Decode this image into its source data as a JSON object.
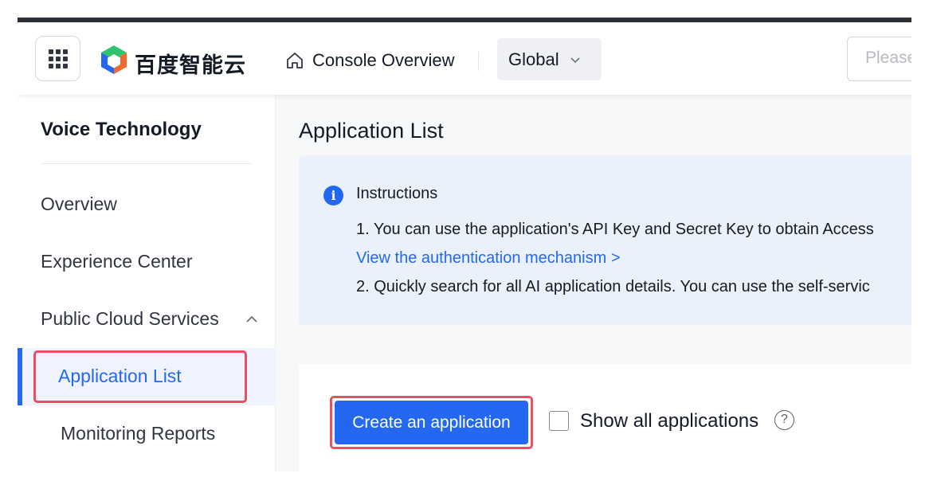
{
  "header": {
    "logo_text": "百度智能云",
    "console_label": "Console Overview",
    "region": "Global",
    "search_placeholder": "Please"
  },
  "sidebar": {
    "title": "Voice Technology",
    "items": [
      {
        "label": "Overview"
      },
      {
        "label": "Experience Center"
      },
      {
        "label": "Public Cloud Services"
      },
      {
        "label": "Application List"
      },
      {
        "label": "Monitoring Reports"
      }
    ]
  },
  "main": {
    "title": "Application List",
    "instructions": {
      "title": "Instructions",
      "line1": "1. You can use the application's API Key and Secret Key to obtain Access",
      "link": "View the authentication mechanism >",
      "line2": "2. Quickly search for all AI application details. You can use the self-servic"
    },
    "create_button": "Create an application",
    "show_all_label": "Show all applications"
  },
  "icons": {
    "apps": "grid-icon",
    "home": "home-icon",
    "chevron": "chevron-down-icon",
    "collapse": "chevron-up-icon",
    "info": "info-icon",
    "help": "help-icon"
  },
  "colors": {
    "primary": "#2468f2",
    "highlight": "#e94e63",
    "info_bg": "#eaf1fd"
  }
}
